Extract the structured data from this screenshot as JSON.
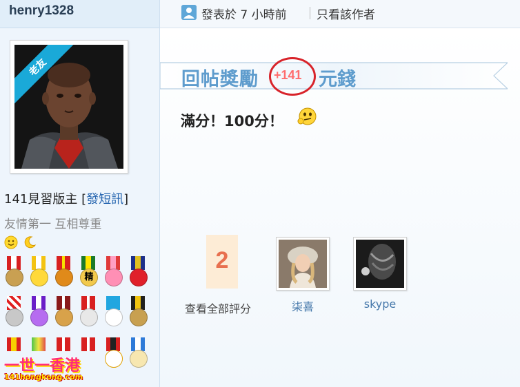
{
  "user": {
    "username": "henry1328",
    "avatar_badge": "老友",
    "rank_prefix": "141見習版主 [",
    "pm_link": "發短訊",
    "rank_suffix": "]",
    "motto": "友情第一 互相尊重",
    "smileys": [
      "smile-icon",
      "moon-icon"
    ],
    "medals": [
      "medal-icon",
      "medal-icon",
      "medal-icon",
      "medal-icon",
      "medal-icon",
      "medal-icon",
      "medal-icon",
      "medal-icon",
      "medal-icon",
      "medal-icon",
      "medal-icon",
      "medal-icon",
      "medal-icon",
      "medal-icon",
      "medal-icon",
      "medal-icon",
      "medal-icon",
      "medal-icon"
    ],
    "medal_glyph_4": "精"
  },
  "site_logo": {
    "text": "一世一香港",
    "url": "141hongkong.com"
  },
  "post": {
    "posted_text": "發表於 7 小時前",
    "author_only": "只看該作者",
    "reward_prefix": "回帖獎勵",
    "reward_amount": "+141",
    "reward_suffix": "元錢",
    "content": "滿分！100分！"
  },
  "rating": {
    "total": "2",
    "view_all": "查看全部評分",
    "raters": [
      {
        "name": "柒喜"
      },
      {
        "name": "skype"
      }
    ]
  },
  "colors": {
    "accent": "#5e9ccd",
    "reward_red": "#ff6d6d",
    "circle": "#d8232a",
    "score": "#e8704f"
  }
}
